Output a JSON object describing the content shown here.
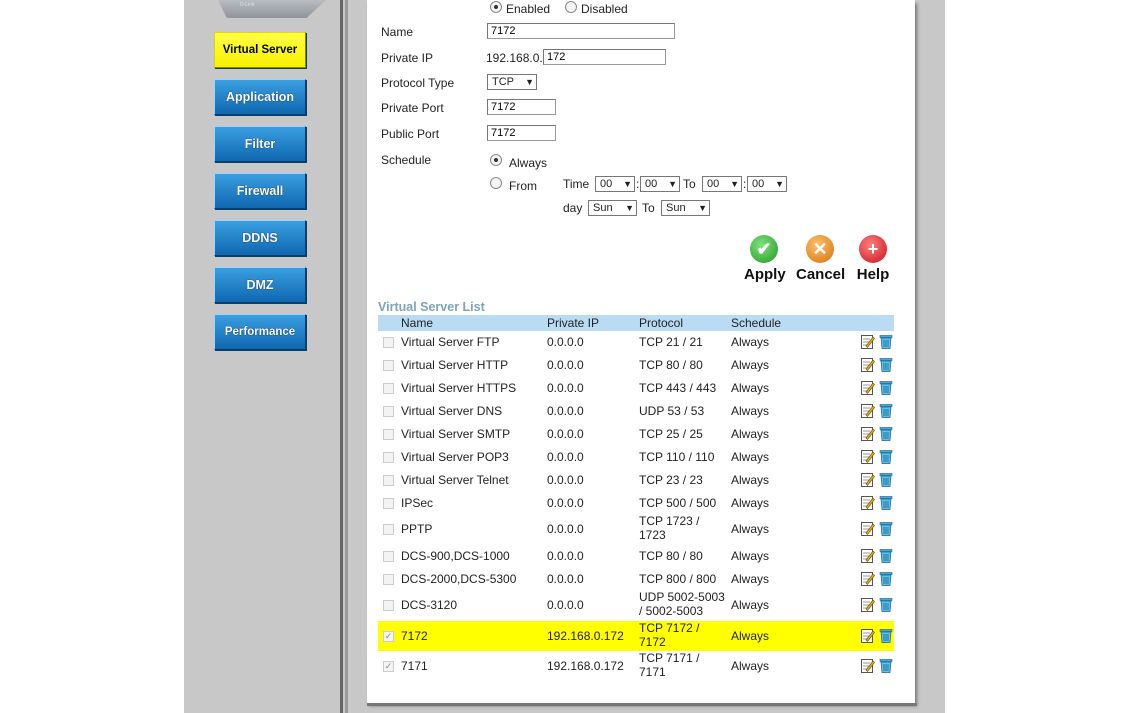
{
  "nav": {
    "items": [
      {
        "label": "Virtual Server",
        "active": true
      },
      {
        "label": "Application",
        "active": false
      },
      {
        "label": "Filter",
        "active": false
      },
      {
        "label": "Firewall",
        "active": false
      },
      {
        "label": "DDNS",
        "active": false
      },
      {
        "label": "DMZ",
        "active": false
      },
      {
        "label": "Performance",
        "active": false
      }
    ],
    "logo_text": "D-Link"
  },
  "form": {
    "status": {
      "enabled_label": "Enabled",
      "disabled_label": "Disabled",
      "selected": "Enabled"
    },
    "name": {
      "label": "Name",
      "value": "7172"
    },
    "private_ip": {
      "label": "Private IP",
      "prefix": "192.168.0.",
      "value": "172"
    },
    "protocol_type": {
      "label": "Protocol Type",
      "value": "TCP"
    },
    "private_port": {
      "label": "Private Port",
      "value": "7172"
    },
    "public_port": {
      "label": "Public Port",
      "value": "7172"
    },
    "schedule": {
      "label": "Schedule",
      "always_label": "Always",
      "from_label": "From",
      "selected": "Always",
      "time_label": "Time",
      "to_label": "To",
      "time_from_hour": "00",
      "time_from_min": "00",
      "time_to_hour": "00",
      "time_to_min": "00",
      "colon": ":",
      "day_label": "day",
      "day_from": "Sun",
      "day_to": "Sun"
    }
  },
  "actions": {
    "apply": "Apply",
    "cancel": "Cancel",
    "help": "Help"
  },
  "list": {
    "title": "Virtual Server List",
    "headers": {
      "name": "Name",
      "private_ip": "Private IP",
      "protocol": "Protocol",
      "schedule": "Schedule"
    },
    "rows": [
      {
        "checked": false,
        "name": "Virtual Server FTP",
        "ip": "0.0.0.0",
        "protocol": "TCP 21 / 21",
        "schedule": "Always",
        "highlight": false
      },
      {
        "checked": false,
        "name": "Virtual Server HTTP",
        "ip": "0.0.0.0",
        "protocol": "TCP 80 / 80",
        "schedule": "Always",
        "highlight": false
      },
      {
        "checked": false,
        "name": "Virtual Server HTTPS",
        "ip": "0.0.0.0",
        "protocol": "TCP 443 / 443",
        "schedule": "Always",
        "highlight": false
      },
      {
        "checked": false,
        "name": "Virtual Server DNS",
        "ip": "0.0.0.0",
        "protocol": "UDP 53 / 53",
        "schedule": "Always",
        "highlight": false
      },
      {
        "checked": false,
        "name": "Virtual Server SMTP",
        "ip": "0.0.0.0",
        "protocol": "TCP 25 / 25",
        "schedule": "Always",
        "highlight": false
      },
      {
        "checked": false,
        "name": "Virtual Server POP3",
        "ip": "0.0.0.0",
        "protocol": "TCP 110 / 110",
        "schedule": "Always",
        "highlight": false
      },
      {
        "checked": false,
        "name": "Virtual Server Telnet",
        "ip": "0.0.0.0",
        "protocol": "TCP 23 / 23",
        "schedule": "Always",
        "highlight": false
      },
      {
        "checked": false,
        "name": "IPSec",
        "ip": "0.0.0.0",
        "protocol": "TCP 500 / 500",
        "schedule": "Always",
        "highlight": false
      },
      {
        "checked": false,
        "name": "PPTP",
        "ip": "0.0.0.0",
        "protocol": "TCP 1723 / 1723",
        "schedule": "Always",
        "highlight": false
      },
      {
        "checked": false,
        "name": "DCS-900,DCS-1000",
        "ip": "0.0.0.0",
        "protocol": "TCP 80 / 80",
        "schedule": "Always",
        "highlight": false
      },
      {
        "checked": false,
        "name": "DCS-2000,DCS-5300",
        "ip": "0.0.0.0",
        "protocol": "TCP 800 / 800",
        "schedule": "Always",
        "highlight": false
      },
      {
        "checked": false,
        "name": "DCS-3120",
        "ip": "0.0.0.0",
        "protocol": "UDP 5002-5003 / 5002-5003",
        "schedule": "Always",
        "highlight": false
      },
      {
        "checked": true,
        "name": "7172",
        "ip": "192.168.0.172",
        "protocol": "TCP 7172 / 7172",
        "schedule": "Always",
        "highlight": true
      },
      {
        "checked": true,
        "name": "7171",
        "ip": "192.168.0.172",
        "protocol": "TCP 7171 / 7171",
        "schedule": "Always",
        "highlight": false
      }
    ]
  },
  "colors": {
    "nav_button": "#1e7fcb",
    "nav_active": "#ffff00",
    "list_header": "#b9dcf4",
    "list_title": "#7fa3b8",
    "highlight_row": "#ffff00",
    "apply": "#2eaa2e",
    "cancel": "#e58a1c",
    "help": "#d8202a"
  }
}
